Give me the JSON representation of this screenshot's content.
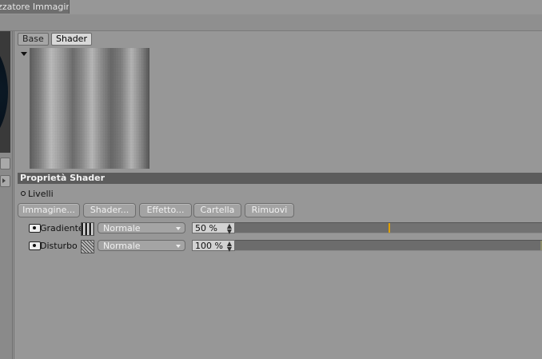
{
  "window": {
    "title": "izzatore Immagini"
  },
  "tabs": [
    {
      "label": "Base",
      "active": false
    },
    {
      "label": "Shader",
      "active": true
    }
  ],
  "section": {
    "title": "Proprietà Shader",
    "layers_label": "Livelli"
  },
  "buttons": [
    {
      "label": "Immagine..."
    },
    {
      "label": "Shader..."
    },
    {
      "label": "Effetto..."
    },
    {
      "label": "Cartella"
    },
    {
      "label": "Rimuovi"
    }
  ],
  "layers": [
    {
      "name": "Gradiente",
      "icon": "gradient-thumbnail-icon",
      "blend_mode": "Normale",
      "opacity_text": "50 %",
      "opacity": 0.5,
      "visible": true
    },
    {
      "name": "Disturbo",
      "icon": "noise-thumbnail-icon",
      "blend_mode": "Normale",
      "opacity_text": "100 %",
      "opacity": 1.0,
      "visible": true
    }
  ],
  "colors": {
    "background": "#979797",
    "header": "#5c5c5c",
    "slider_marker": "#e0a000"
  }
}
